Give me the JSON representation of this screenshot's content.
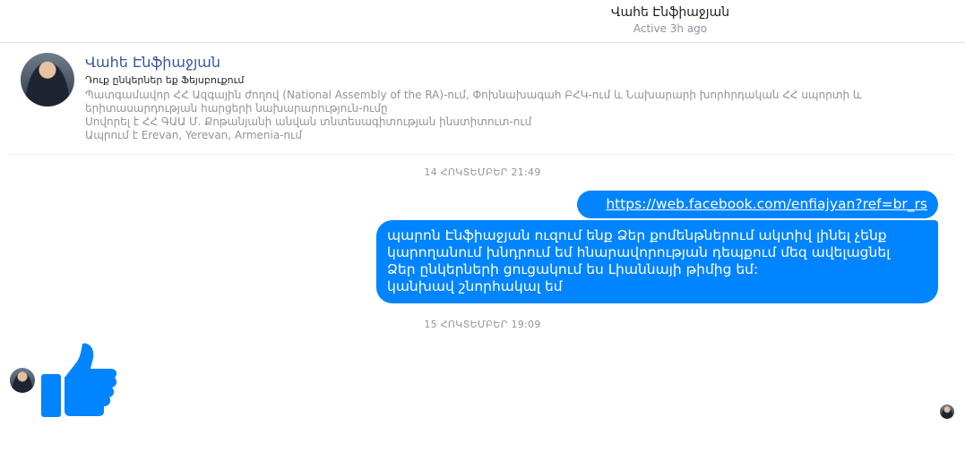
{
  "header": {
    "name": "Վահե Էնֆիաջյան",
    "status": "Active 3h ago"
  },
  "profile": {
    "name": "Վահե Էնֆիաջյան",
    "subtitle": "Դուք ընկերներ եք Ֆեյսբուքում",
    "info": [
      "Պատգամավոր ՀՀ Ազգային ժողով (National Assembly of the RA)-ում, Փոխնախագահ ԲՀԿ-ում և Նախարարի խորհրդական ՀՀ սպորտի և\nերիտասարդության հարցերի նախարարություն-ումը",
      "Սովորել է ՀՀ ԳԱԱ Մ. Քոթանյանի անվան տնտեսագիտության ինստիտուտ-ում",
      "Ապրում է Erevan, Yerevan, Armenia-ում"
    ]
  },
  "messages": {
    "timestamp_1": "14 ՀՈԿՏԵՄԲԵՐ 21:49",
    "link": "https://web.facebook.com/enfiajyan?ref=br_rs",
    "text": "պարոն Էնֆիաջյան ուզում ենք Ձեր քոմենթներում ակտիվ լինել չենք\nկարողանում խնդրում եմ հնարավորության դեպքում մեզ ավելացնել\nՁեր ընկերների ցուցակում ես Լիաննայի թիմից եմ:\n կանխավ շնորհակալ եմ",
    "timestamp_2": "15 ՀՈԿՏԵՄԲԵՐ 19:09"
  },
  "icons": {
    "like": "thumbs-up-icon",
    "accent": "#0084ff"
  }
}
